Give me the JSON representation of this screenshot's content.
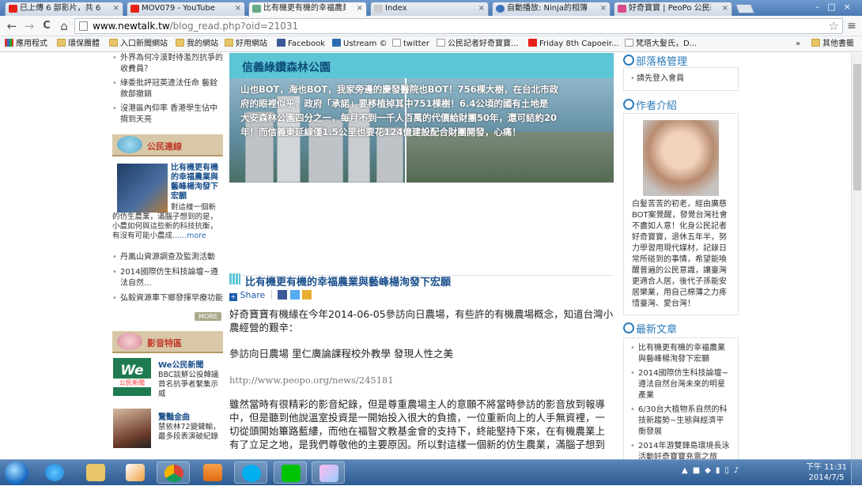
{
  "tabs": [
    {
      "title": "已上傳 6 部影片，共 6 部"
    },
    {
      "title": "MOV079 - YouTube"
    },
    {
      "title": "比有機更有機的幸福農業與"
    },
    {
      "title": "Index"
    },
    {
      "title": "自動播放: Ninja的相簿「仁"
    },
    {
      "title": "好奇寶寶 | PeoPo 公民新聞"
    }
  ],
  "toolbar": {
    "back": "←",
    "forward": "→",
    "reload": "C",
    "home": "⌂",
    "url_host": "www.newtalk.tw",
    "url_path": "/blog_read.php?oid=21031",
    "star": "☆",
    "menu": "≡"
  },
  "bookmarks": [
    {
      "label": "應用程式"
    },
    {
      "label": "環保團體"
    },
    {
      "label": "入口新聞網站"
    },
    {
      "label": "我的網站"
    },
    {
      "label": "好用網站"
    },
    {
      "label": "Facebook"
    },
    {
      "label": "Ustream ©"
    },
    {
      "label": "twitter"
    },
    {
      "label": "公民記者好奇寶寶..."
    },
    {
      "label": "Friday 8th Capoeir..."
    },
    {
      "label": "梵塔大髮氏，D..."
    }
  ],
  "bookmarks_overflow": "»",
  "bookmarks_other": "其他書籤",
  "left": {
    "top_links": [
      "外界為何冷漠對待濫烈抗爭的收費員？",
      "綠委批評冠英違法任命 藝銓敘部撤銷",
      "沒港區內仰率 香港學生佔中揹到天亮"
    ],
    "section1_title": "公民連線",
    "feature_title": "比有機更有機的幸福農業與藝峰楊洵發下宏願",
    "feature_desc": "對這樣一個新的仿生農業，滿腦子想到的是，小農如何與這些新的科技抗衡，有沒有可能小農成",
    "feature_more": "......more",
    "more_links": [
      "丹鳳山資源調查及監測活動",
      "2014國際仿生科技論壇~遵法自然...",
      "弘毅資源車下鄉發揮早療功能"
    ],
    "more_btn": "MORE",
    "section2_title": "影音特區",
    "video1_title": "We公民新聞",
    "video1_desc": "BBC談鮮公投韓議首名抗爭者繫集示威",
    "video1_logo": "We",
    "video1_logo_sub": "公民新聞",
    "video2_title": "驚豔金曲",
    "video2_desc": "禁依林72變聲輸，最多段表演破紀錄"
  },
  "hero": {
    "title": "信義綠鑽森林公園",
    "lines": [
      "山也BOT，海也BOT，我家旁邊的慶發醫院也BOT！756棵大樹，在台北市政",
      "府的眼裡似乎，政府「承諾」要移植掉其中751棵樹！6.4公頃的國有土地是",
      "大安森林公園四分之一，每月不到一千人百萬的代價給財團50年，還可結約20",
      "年！而信義東延線僅1.5公里也要花124億建設配合財團開發，心痛！"
    ]
  },
  "article": {
    "title": "比有機更有機的幸福農業與藝峰楊洵發下宏願",
    "share_label": "Share",
    "paras": [
      "好奇寶寶有機緣在今年2014-06-05參訪向日農場，有些許的有機農場概念，知道台灣小農經營的艱辛：",
      "參訪向日農場 里仁廣論課程校外教學 發現人性之美",
      "http://www.peopo.org/news/245181",
      "雖然當時有很精彩的影音紀錄，但是尊重農場主人的意願不將當時參訪的影音放到報導中，但是聽到他說溫室投資是一開始投入很大的負擔，一位重新向上的人手無資裡，一切從頭開始篳路藍縷，而他在福智文教基金會的支持下，終能堅持下來，在有機農業上有了立足之地，是我們尊敬他的主要原因。所以對這樣一個新的仿生農業，滿腦子想到"
    ]
  },
  "right": {
    "blog_title": "部落格管理",
    "login_text": "請先登入會員",
    "author_title": "作者介紹",
    "author_bio": "白髮苦苦的初老，經由廣慈BOT案覺醒，發覺台灣社會不盡如人意！化身公民記者好奇寶寶，退休五年半，努力學習用現代媒材，記錄日常所碰到的事情，希望能喚醒普遍的公民意識，讓臺灣更適合人居，後代子孫能安居樂業，用自己棉薄之力疼惜臺灣、愛台灣！",
    "latest_title": "最新文章",
    "latest": [
      "比有機更有機的幸福農業與藝峰楊洵發下宏願",
      "2014國際仿生科技論壇~遵法自然台灣未來的明星產業",
      "6/30台大植物系自然的科技新趨勢~生態與經濟平衡發展",
      "2014年游雙鋒島環境長泳活動好奇寶寶充電之旅"
    ]
  },
  "taskbar": {
    "time": "下午 11:31",
    "date": "2014/7/5"
  },
  "colors": {
    "accent": "#2d7cb8",
    "hero_bg": "#5cc5d6",
    "section_bar": "#d9c8a8",
    "section_label": "#c0392b"
  }
}
